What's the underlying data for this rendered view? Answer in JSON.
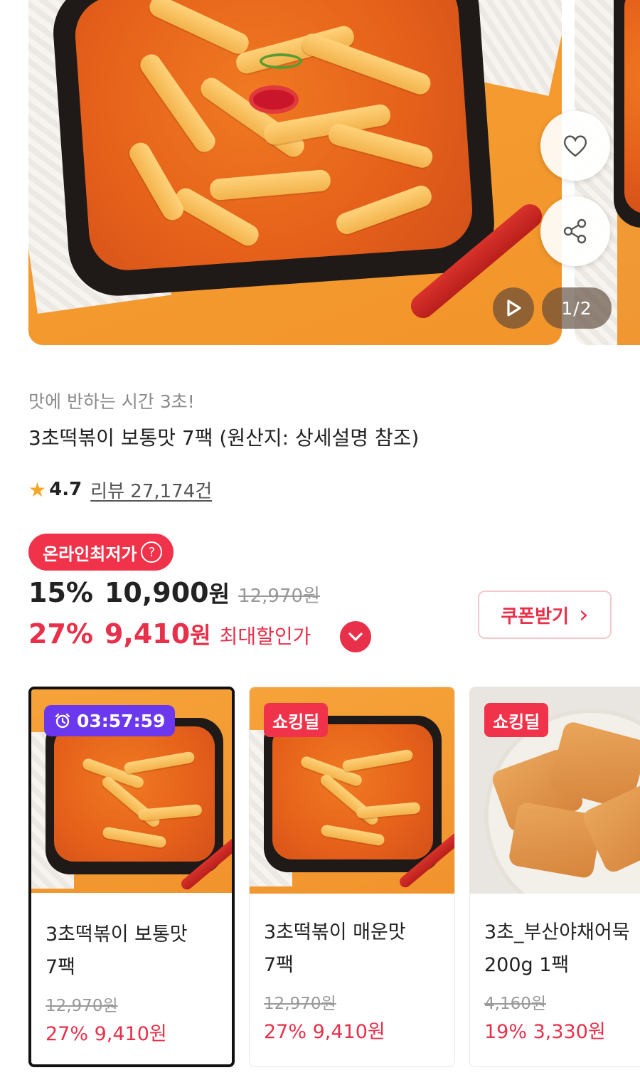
{
  "gallery": {
    "pager": "1/2",
    "icons": {
      "like": "heart-icon",
      "share": "share-icon",
      "play": "play-icon"
    }
  },
  "product": {
    "subtitle": "맛에 반하는 시간 3초!",
    "title": "3초떡볶이 보통맛 7팩 (원산지: 상세설명 참조)",
    "rating": "4.7",
    "review_text": "리뷰 27,174건",
    "badge": "온라인최저가",
    "badge_help": "?",
    "price": {
      "pct": "15%",
      "amount": "10,900",
      "won": "원",
      "original": "12,970원"
    },
    "max_price": {
      "pct": "27%",
      "amount": "9,410",
      "won": "원",
      "label": "최대할인가"
    },
    "coupon_label": "쿠폰받기",
    "coupon_arrow": "›"
  },
  "related": [
    {
      "timer": "03:57:59",
      "name": "3초떡볶이 보통맛\n7팩",
      "original": "12,970원",
      "sale": "27% 9,410원"
    },
    {
      "badge": "쇼킹딜",
      "name": "3초떡볶이 매운맛\n7팩",
      "original": "12,970원",
      "sale": "27% 9,410원"
    },
    {
      "badge": "쇼킹딜",
      "name": "3초_부산야채어묵\n200g 1팩",
      "original": "4,160원",
      "sale": "19% 3,330원"
    }
  ],
  "colors": {
    "accent": "#e8304a",
    "badge": "#f0334a",
    "timer": "#6c38ef",
    "star": "#f5a623"
  }
}
